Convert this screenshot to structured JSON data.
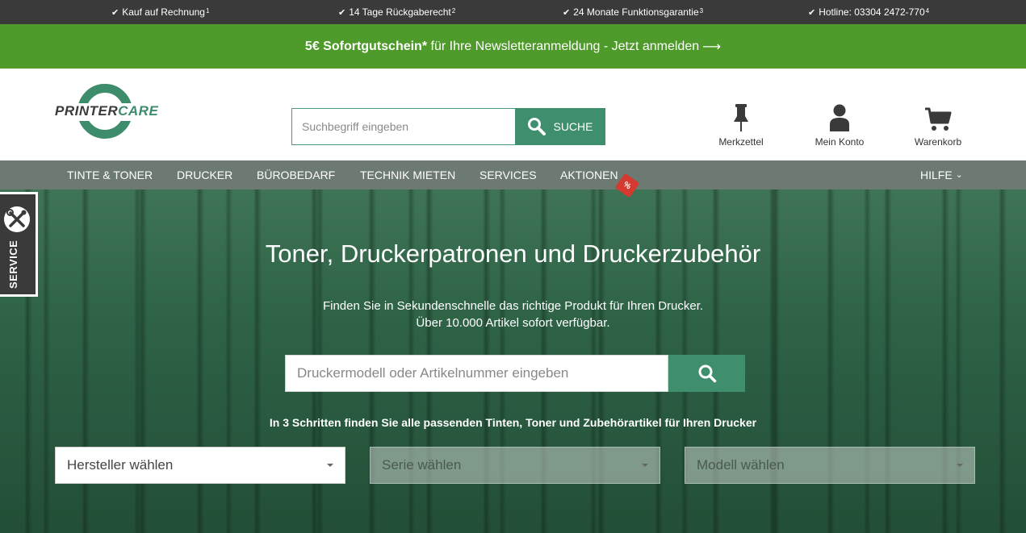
{
  "usp": [
    {
      "text": "Kauf auf Rechnung",
      "note": "1"
    },
    {
      "text": "14 Tage Rückgaberecht",
      "note": "2"
    },
    {
      "text": "24 Monate Funktionsgarantie",
      "note": "3"
    },
    {
      "text": "Hotline: 03304 2472-770",
      "note": "4"
    }
  ],
  "newsletter": {
    "bold": "5€ Sofortgutschein*",
    "text": " für Ihre Newsletteranmeldung - Jetzt anmelden",
    "arrow": "⟶"
  },
  "logo": {
    "part1": "PRINTER",
    "part2": "CARE",
    "brand_color": "#3d8c6b"
  },
  "header_search": {
    "placeholder": "Suchbegriff eingeben",
    "value": "",
    "button_label": "SUCHE"
  },
  "header_links": [
    {
      "label": "Merkzettel",
      "icon": "pin-icon"
    },
    {
      "label": "Mein Konto",
      "icon": "user-icon"
    },
    {
      "label": "Warenkorb",
      "icon": "cart-icon"
    }
  ],
  "nav": {
    "items": [
      "TINTE & TONER",
      "DRUCKER",
      "BÜROBEDARF",
      "TECHNIK MIETEN",
      "SERVICES",
      "AKTIONEN"
    ],
    "badge": "%",
    "help": "HILFE",
    "help_caret": "⌄"
  },
  "service_tab": {
    "label": "SERVICE",
    "icon": "tools-icon"
  },
  "hero": {
    "title": "Toner, Druckerpatronen und Druckerzubehör",
    "subtitle_line1": "Finden Sie in Sekundenschnelle das richtige Produkt für Ihren Drucker.",
    "subtitle_line2": "Über 10.000 Artikel sofort verfügbar.",
    "search_placeholder": "Druckermodell oder Artikelnummer eingeben",
    "search_value": "",
    "steps_text": "In 3 Schritten finden Sie alle passenden Tinten, Toner und Zubehörartikel für Ihren Drucker",
    "selects": [
      {
        "label": "Hersteller wählen",
        "state": "active"
      },
      {
        "label": "Serie wählen",
        "state": "disabled"
      },
      {
        "label": "Modell wählen",
        "state": "disabled"
      }
    ]
  },
  "colors": {
    "accent": "#3f8f6e",
    "newsletter_bg": "#4e9a2a",
    "nav_bg": "#6c7a72",
    "top_bar_bg": "#3a3a3a",
    "badge": "#d43a2f"
  }
}
